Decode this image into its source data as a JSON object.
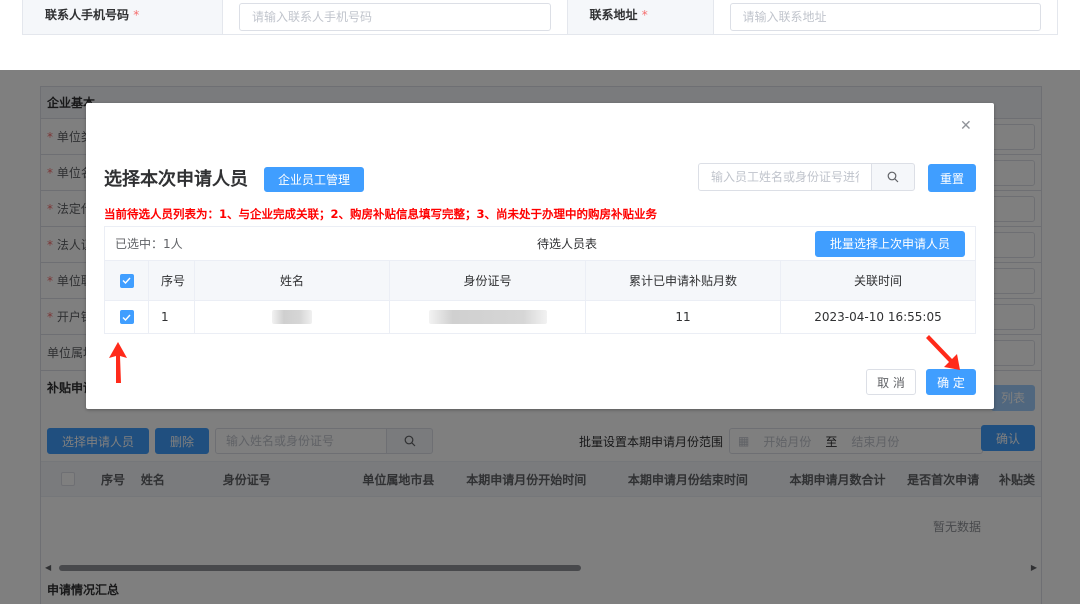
{
  "top_form": {
    "phone_label": "联系人手机号码",
    "phone_placeholder": "请输入联系人手机号码",
    "address_label": "联系地址",
    "address_placeholder": "请输入联系地址",
    "required_mark": "*"
  },
  "background": {
    "section_title": "企业基本",
    "rows": [
      {
        "label": "单位类",
        "required": true
      },
      {
        "label": "单位名",
        "required": true
      },
      {
        "label": "法定代",
        "required": true
      },
      {
        "label": "法人证",
        "required": true
      },
      {
        "label": "单位联",
        "required": true
      },
      {
        "label": "开户银",
        "required": true
      },
      {
        "label": "单位属地",
        "required": false
      }
    ],
    "subsidy_section": "补贴申请",
    "list_button": "列表",
    "select_applicant_button": "选择申请人员",
    "delete_button": "删除",
    "search_placeholder": "输入姓名或身份证号",
    "batch_range_label": "批量设置本期申请月份范围",
    "start_month_placeholder": "开始月份",
    "range_separator": "至",
    "end_month_placeholder": "结束月份",
    "confirm_button": "确认",
    "table_headers": [
      "序号",
      "姓名",
      "身份证号",
      "单位属地市县",
      "本期申请月份开始时间",
      "本期申请月份结束时间",
      "本期申请月数合计",
      "是否首次申请",
      "补贴类"
    ],
    "empty_text": "暂无数据",
    "summary_title": "申请情况汇总"
  },
  "dialog": {
    "title": "选择本次申请人员",
    "employee_mgmt_button": "企业员工管理",
    "search_placeholder": "输入员工姓名或身份证号进行",
    "reset_button": "重置",
    "notice": "当前待选人员列表为：1、与企业完成关联；2、购房补贴信息填写完整；3、尚未处于办理中的购房补贴业务",
    "selected_count": "已选中：1人",
    "table_title": "待选人员表",
    "batch_select_button": "批量选择上次申请人员",
    "headers": {
      "no": "序号",
      "name": "姓名",
      "id": "身份证号",
      "months": "累计已申请补贴月数",
      "time": "关联时间"
    },
    "rows": [
      {
        "no": "1",
        "checked": true,
        "months": "11",
        "time": "2023-04-10 16:55:05"
      }
    ],
    "cancel_button": "取 消",
    "ok_button": "确 定"
  },
  "colors": {
    "primary": "#409eff",
    "danger": "#f56c6c",
    "notice_red": "#ff0000",
    "annotation_red": "#ff2a1a"
  }
}
